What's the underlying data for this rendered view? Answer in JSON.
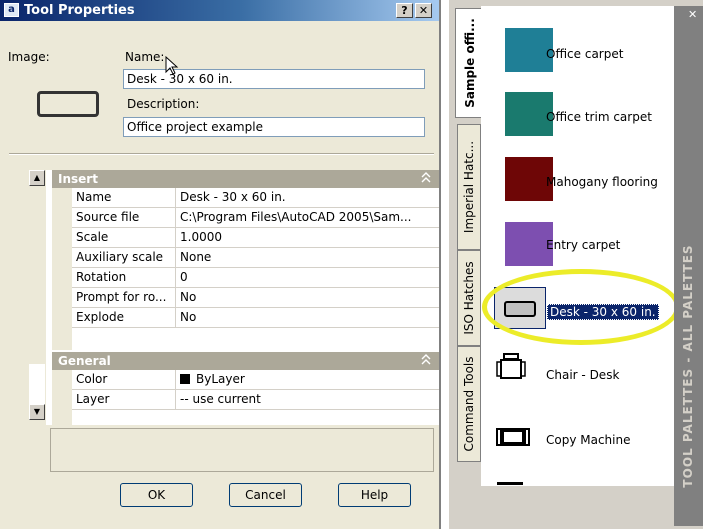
{
  "dialog": {
    "title": "Tool Properties",
    "help_btn": "?",
    "close_btn": "✕",
    "image_label": "Image:",
    "name_label": "Name:",
    "name_value": "Desk - 30 x 60 in.",
    "description_label": "Description:",
    "description_value": "Office project example",
    "sections": [
      {
        "title": "Insert",
        "rows": [
          {
            "key": "Name",
            "value": "Desk - 30 x 60 in."
          },
          {
            "key": "Source file",
            "value": "C:\\Program Files\\AutoCAD 2005\\Sam..."
          },
          {
            "key": "Scale",
            "value": "1.0000"
          },
          {
            "key": "Auxiliary scale",
            "value": "None"
          },
          {
            "key": "Rotation",
            "value": "0"
          },
          {
            "key": "Prompt for ro...",
            "value": "No"
          },
          {
            "key": "Explode",
            "value": "No"
          }
        ]
      },
      {
        "title": "General",
        "rows": [
          {
            "key": "Color",
            "value": "ByLayer"
          },
          {
            "key": "Layer",
            "value": "-- use current"
          }
        ]
      }
    ],
    "collapse_glyph": "⌃",
    "buttons": {
      "ok": "OK",
      "cancel": "Cancel",
      "help": "Help"
    }
  },
  "palette": {
    "tabs": [
      "Sample offi...",
      "Imperial Hatc...",
      "ISO Hatches",
      "Command Tools"
    ],
    "active_tab": "Sample offi...",
    "items": [
      {
        "label": "Office carpet",
        "color": "#1f7f96"
      },
      {
        "label": "Office trim carpet",
        "color": "#1a7a6e"
      },
      {
        "label": "Mahogany flooring",
        "color": "#6e0606"
      },
      {
        "label": "Entry carpet",
        "color": "#7d4fb0"
      },
      {
        "label": "Desk - 30 x 60 in.",
        "icon": "desk-icon"
      },
      {
        "label": "Chair - Desk",
        "icon": "chair-icon"
      },
      {
        "label": "Copy Machine",
        "icon": "copy-machine-icon"
      }
    ],
    "side_title": "TOOL PALETTES - ALL PALETTES",
    "close_glyph": "✕"
  }
}
